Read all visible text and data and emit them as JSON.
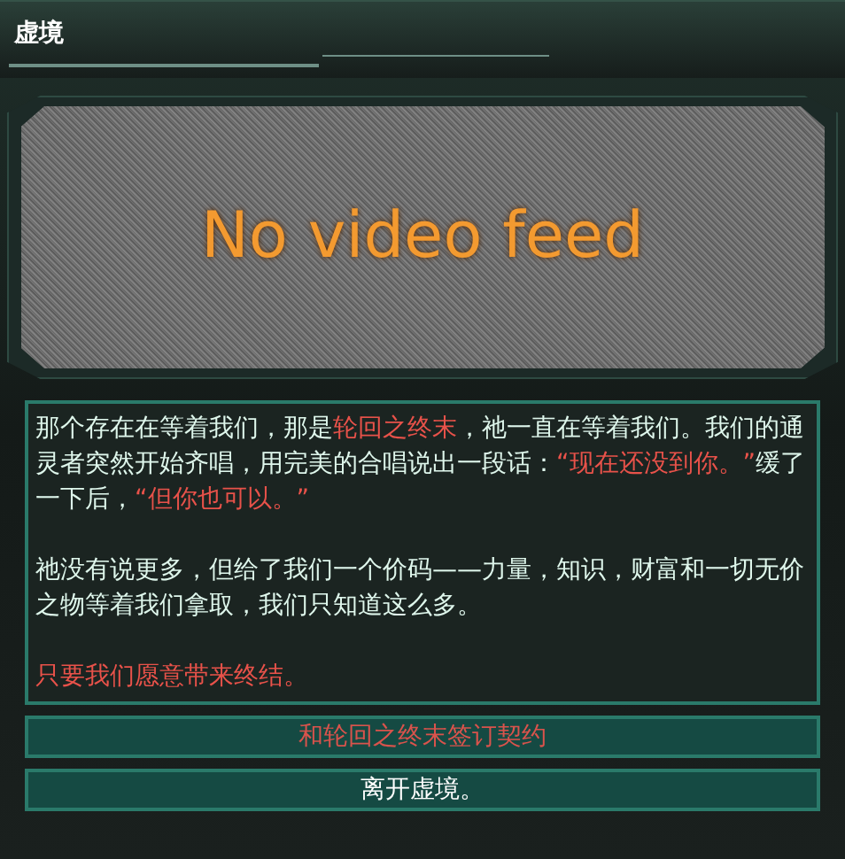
{
  "window": {
    "title": "虚境"
  },
  "video": {
    "message": "No video feed"
  },
  "paragraphs": [
    {
      "runs": [
        {
          "text": "那个存在在等着我们，那是",
          "emphasis": false
        },
        {
          "text": "轮回之终末",
          "emphasis": true
        },
        {
          "text": "，祂一直在等着我们。我们的通灵者突然开始齐唱，用完美的合唱说出一段话：",
          "emphasis": false
        },
        {
          "text": "“现在还没到你。”",
          "emphasis": true
        },
        {
          "text": "缓了一下后，",
          "emphasis": false
        },
        {
          "text": "“但你也可以。”",
          "emphasis": true
        }
      ]
    },
    {
      "runs": [
        {
          "text": "祂没有说更多，但给了我们一个价码——力量，知识，财富和一切无价之物等着我们拿取，我们只知道这么多。",
          "emphasis": false
        }
      ]
    },
    {
      "runs": [
        {
          "text": "只要我们愿意带来终结。",
          "emphasis": true
        }
      ]
    }
  ],
  "options": [
    {
      "label": "和轮回之终末签订契约",
      "emphasis": true
    },
    {
      "label": "离开虚境。",
      "emphasis": false
    }
  ]
}
